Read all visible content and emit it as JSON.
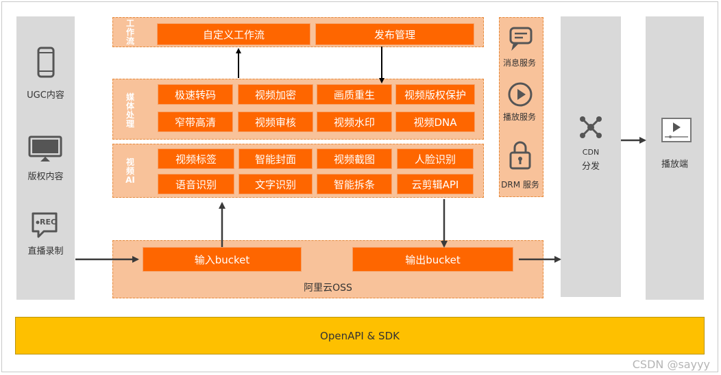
{
  "sources": {
    "ugc_label": "UGC内容",
    "copyright_label": "版权内容",
    "live_label": "直播录制",
    "rec_badge": "REC"
  },
  "workflow": {
    "label": "工作流",
    "items": [
      "自定义工作流",
      "发布管理"
    ]
  },
  "media_processing": {
    "label": "媒体处理",
    "items": [
      "极速转码",
      "视频加密",
      "画质重生",
      "视频版权保护",
      "窄带高清",
      "视频审核",
      "视频水印",
      "视频DNA"
    ]
  },
  "video_ai": {
    "label": "视频AI",
    "items": [
      "视频标签",
      "智能封面",
      "视频截图",
      "人脸识别",
      "语音识别",
      "文字识别",
      "智能拆条",
      "云剪辑API"
    ]
  },
  "oss": {
    "input_bucket": "输入bucket",
    "output_bucket": "输出bucket",
    "label": "阿里云OSS"
  },
  "services": {
    "message": "消息服务",
    "playback": "播放服务",
    "drm": "DRM 服务"
  },
  "cdn": {
    "line1": "CDN",
    "line2": "分发"
  },
  "player": {
    "label": "播放端"
  },
  "api_bar": {
    "label": "OpenAPI & SDK"
  },
  "watermark": "CSDN @sayyy",
  "colors": {
    "orange_button": "#fe6600",
    "panel_fill": "#f8c29a",
    "gray_column": "#d9d9d9",
    "api_bar": "#fec000"
  }
}
